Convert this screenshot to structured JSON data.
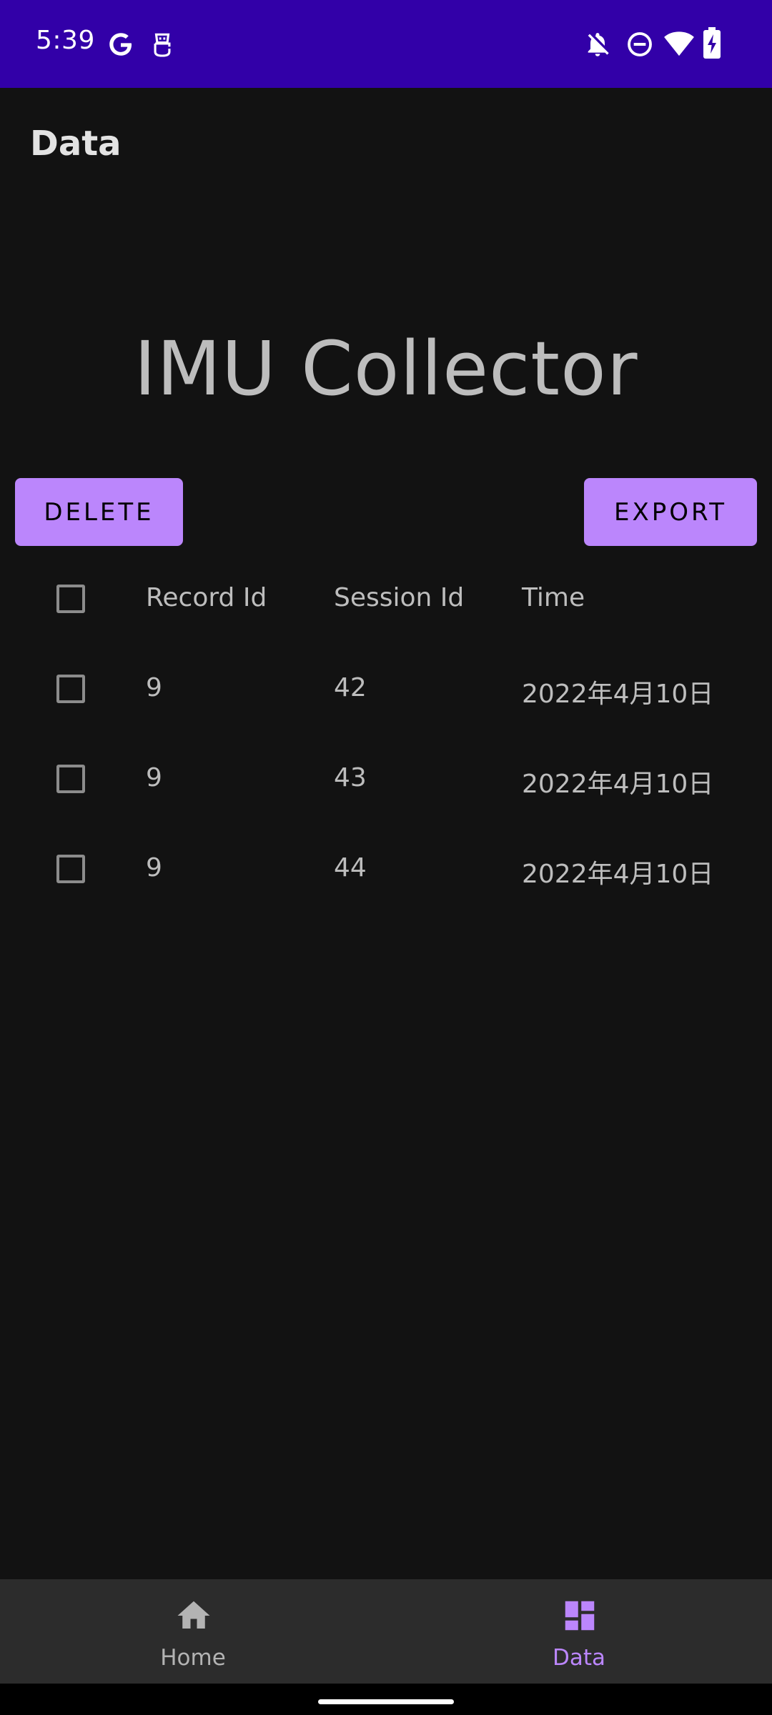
{
  "status_bar": {
    "time": "5:39",
    "icons_left": [
      "google-icon",
      "robot-icon"
    ],
    "icons_right": [
      "notifications-off-icon",
      "do-not-disturb-icon",
      "wifi-icon",
      "battery-charging-icon"
    ]
  },
  "app_bar": {
    "title": "Data"
  },
  "hero": {
    "title": "IMU Collector"
  },
  "actions": {
    "delete_label": "DELETE",
    "export_label": "EXPORT"
  },
  "table": {
    "headers": [
      "Record Id",
      "Session Id",
      "Time"
    ],
    "rows": [
      {
        "record_id": "9",
        "session_id": "42",
        "time": "2022年4月10日",
        "checked": false
      },
      {
        "record_id": "9",
        "session_id": "43",
        "time": "2022年4月10日",
        "checked": false
      },
      {
        "record_id": "9",
        "session_id": "44",
        "time": "2022年4月10日",
        "checked": false
      }
    ]
  },
  "bottom_nav": {
    "items": [
      {
        "label": "Home",
        "icon": "home-icon",
        "selected": false
      },
      {
        "label": "Data",
        "icon": "dashboard-icon",
        "selected": true
      }
    ]
  },
  "colors": {
    "status_bar": "#3200a8",
    "background": "#121212",
    "accent": "#bb86fc",
    "nav_background": "#2c2c2c"
  }
}
